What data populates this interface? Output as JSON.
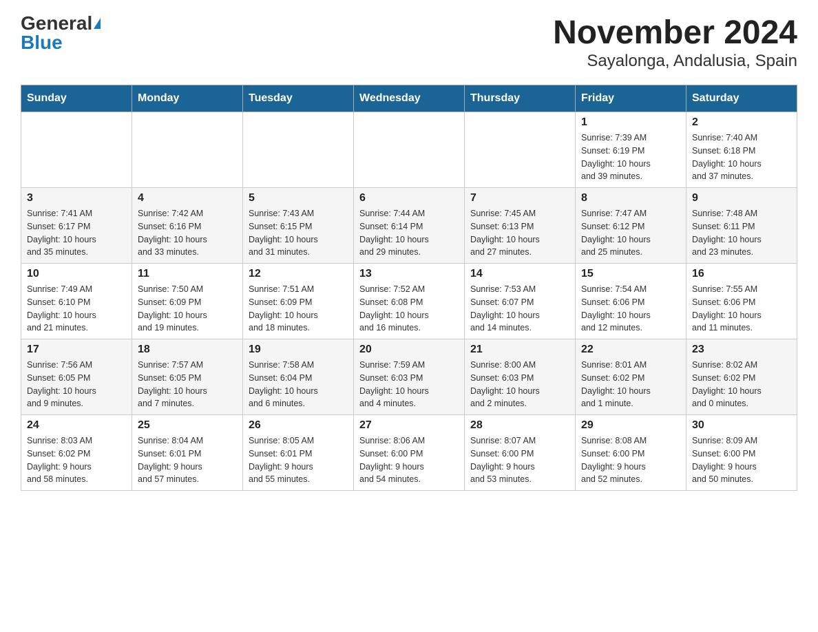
{
  "header": {
    "logo_general": "General",
    "logo_blue": "Blue",
    "title": "November 2024",
    "subtitle": "Sayalonga, Andalusia, Spain"
  },
  "days_of_week": [
    "Sunday",
    "Monday",
    "Tuesday",
    "Wednesday",
    "Thursday",
    "Friday",
    "Saturday"
  ],
  "weeks": [
    {
      "days": [
        {
          "number": "",
          "info": ""
        },
        {
          "number": "",
          "info": ""
        },
        {
          "number": "",
          "info": ""
        },
        {
          "number": "",
          "info": ""
        },
        {
          "number": "",
          "info": ""
        },
        {
          "number": "1",
          "info": "Sunrise: 7:39 AM\nSunset: 6:19 PM\nDaylight: 10 hours\nand 39 minutes."
        },
        {
          "number": "2",
          "info": "Sunrise: 7:40 AM\nSunset: 6:18 PM\nDaylight: 10 hours\nand 37 minutes."
        }
      ]
    },
    {
      "days": [
        {
          "number": "3",
          "info": "Sunrise: 7:41 AM\nSunset: 6:17 PM\nDaylight: 10 hours\nand 35 minutes."
        },
        {
          "number": "4",
          "info": "Sunrise: 7:42 AM\nSunset: 6:16 PM\nDaylight: 10 hours\nand 33 minutes."
        },
        {
          "number": "5",
          "info": "Sunrise: 7:43 AM\nSunset: 6:15 PM\nDaylight: 10 hours\nand 31 minutes."
        },
        {
          "number": "6",
          "info": "Sunrise: 7:44 AM\nSunset: 6:14 PM\nDaylight: 10 hours\nand 29 minutes."
        },
        {
          "number": "7",
          "info": "Sunrise: 7:45 AM\nSunset: 6:13 PM\nDaylight: 10 hours\nand 27 minutes."
        },
        {
          "number": "8",
          "info": "Sunrise: 7:47 AM\nSunset: 6:12 PM\nDaylight: 10 hours\nand 25 minutes."
        },
        {
          "number": "9",
          "info": "Sunrise: 7:48 AM\nSunset: 6:11 PM\nDaylight: 10 hours\nand 23 minutes."
        }
      ]
    },
    {
      "days": [
        {
          "number": "10",
          "info": "Sunrise: 7:49 AM\nSunset: 6:10 PM\nDaylight: 10 hours\nand 21 minutes."
        },
        {
          "number": "11",
          "info": "Sunrise: 7:50 AM\nSunset: 6:09 PM\nDaylight: 10 hours\nand 19 minutes."
        },
        {
          "number": "12",
          "info": "Sunrise: 7:51 AM\nSunset: 6:09 PM\nDaylight: 10 hours\nand 18 minutes."
        },
        {
          "number": "13",
          "info": "Sunrise: 7:52 AM\nSunset: 6:08 PM\nDaylight: 10 hours\nand 16 minutes."
        },
        {
          "number": "14",
          "info": "Sunrise: 7:53 AM\nSunset: 6:07 PM\nDaylight: 10 hours\nand 14 minutes."
        },
        {
          "number": "15",
          "info": "Sunrise: 7:54 AM\nSunset: 6:06 PM\nDaylight: 10 hours\nand 12 minutes."
        },
        {
          "number": "16",
          "info": "Sunrise: 7:55 AM\nSunset: 6:06 PM\nDaylight: 10 hours\nand 11 minutes."
        }
      ]
    },
    {
      "days": [
        {
          "number": "17",
          "info": "Sunrise: 7:56 AM\nSunset: 6:05 PM\nDaylight: 10 hours\nand 9 minutes."
        },
        {
          "number": "18",
          "info": "Sunrise: 7:57 AM\nSunset: 6:05 PM\nDaylight: 10 hours\nand 7 minutes."
        },
        {
          "number": "19",
          "info": "Sunrise: 7:58 AM\nSunset: 6:04 PM\nDaylight: 10 hours\nand 6 minutes."
        },
        {
          "number": "20",
          "info": "Sunrise: 7:59 AM\nSunset: 6:03 PM\nDaylight: 10 hours\nand 4 minutes."
        },
        {
          "number": "21",
          "info": "Sunrise: 8:00 AM\nSunset: 6:03 PM\nDaylight: 10 hours\nand 2 minutes."
        },
        {
          "number": "22",
          "info": "Sunrise: 8:01 AM\nSunset: 6:02 PM\nDaylight: 10 hours\nand 1 minute."
        },
        {
          "number": "23",
          "info": "Sunrise: 8:02 AM\nSunset: 6:02 PM\nDaylight: 10 hours\nand 0 minutes."
        }
      ]
    },
    {
      "days": [
        {
          "number": "24",
          "info": "Sunrise: 8:03 AM\nSunset: 6:02 PM\nDaylight: 9 hours\nand 58 minutes."
        },
        {
          "number": "25",
          "info": "Sunrise: 8:04 AM\nSunset: 6:01 PM\nDaylight: 9 hours\nand 57 minutes."
        },
        {
          "number": "26",
          "info": "Sunrise: 8:05 AM\nSunset: 6:01 PM\nDaylight: 9 hours\nand 55 minutes."
        },
        {
          "number": "27",
          "info": "Sunrise: 8:06 AM\nSunset: 6:00 PM\nDaylight: 9 hours\nand 54 minutes."
        },
        {
          "number": "28",
          "info": "Sunrise: 8:07 AM\nSunset: 6:00 PM\nDaylight: 9 hours\nand 53 minutes."
        },
        {
          "number": "29",
          "info": "Sunrise: 8:08 AM\nSunset: 6:00 PM\nDaylight: 9 hours\nand 52 minutes."
        },
        {
          "number": "30",
          "info": "Sunrise: 8:09 AM\nSunset: 6:00 PM\nDaylight: 9 hours\nand 50 minutes."
        }
      ]
    }
  ]
}
